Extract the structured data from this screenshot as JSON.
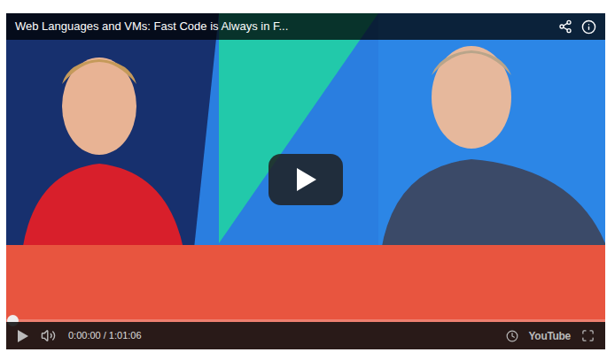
{
  "player": {
    "title": "Web Languages and VMs: Fast Code is Always in F...",
    "playing": false,
    "muted": false,
    "progress": {
      "level": 0
    },
    "time": "0:00:00 / 1:01:06",
    "logo": "YouTube"
  }
}
